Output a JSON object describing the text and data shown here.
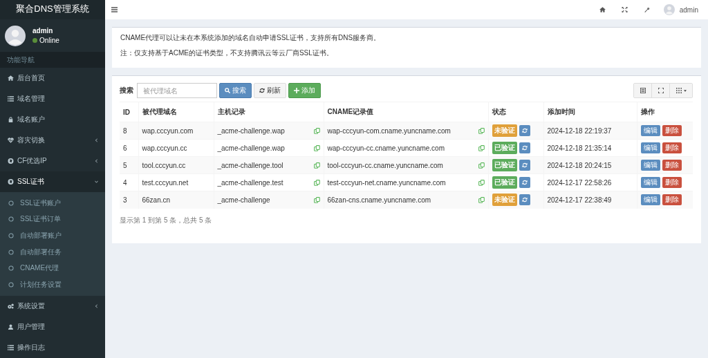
{
  "brand": "聚合DNS管理系统",
  "user": {
    "name": "admin",
    "status": "Online"
  },
  "nav_header": "功能导航",
  "sidebar": {
    "items": [
      {
        "label": "后台首页",
        "selected": false
      },
      {
        "label": "域名管理",
        "selected": false
      },
      {
        "label": "域名账户",
        "selected": false
      },
      {
        "label": "容灾切换",
        "expanded": false,
        "selected": false
      },
      {
        "label": "CF优选IP",
        "expanded": false,
        "selected": false
      },
      {
        "label": "SSL证书",
        "expanded": true,
        "selected": true,
        "children": [
          {
            "label": "SSL证书账户",
            "selected": false
          },
          {
            "label": "SSL证书订单",
            "selected": false
          },
          {
            "label": "自动部署账户",
            "selected": false
          },
          {
            "label": "自动部署任务",
            "selected": false
          },
          {
            "label": "CNAME代理",
            "selected": false
          },
          {
            "label": "计划任务设置",
            "selected": false
          }
        ]
      },
      {
        "label": "系统设置",
        "expanded": false,
        "selected": false
      },
      {
        "label": "用户管理",
        "selected": false
      },
      {
        "label": "操作日志",
        "selected": false
      }
    ]
  },
  "topbar": {
    "user": "admin"
  },
  "notice": [
    "CNAME代理可以让未在本系统添加的域名自动申请SSL证书，支持所有DNS服务商。",
    "注：仅支持基于ACME的证书类型，不支持腾讯云等云厂商SSL证书。"
  ],
  "toolbar": {
    "label": "搜索",
    "placeholder": "被代理域名",
    "buttons": [
      {
        "label": "搜索",
        "kind": "search"
      },
      {
        "label": "刷新",
        "kind": "refresh"
      },
      {
        "label": "添加",
        "kind": "add"
      }
    ]
  },
  "table": {
    "columns": [
      "ID",
      "被代理域名",
      "主机记录",
      "CNAME记录值",
      "状态",
      "添加时间",
      "操作"
    ],
    "rows": [
      {
        "id": "8",
        "domain": "wap.cccyun.com",
        "host": "_acme-challenge.wap",
        "cname": "wap-cccyun-com.cname.yuncname.com",
        "status": "未验证",
        "verified": false,
        "time": "2024-12-18 22:19:37",
        "actions": [
          "编辑",
          "删除"
        ]
      },
      {
        "id": "6",
        "domain": "wap.cccyun.cc",
        "host": "_acme-challenge.wap",
        "cname": "wap-cccyun-cc.cname.yuncname.com",
        "status": "已验证",
        "verified": true,
        "time": "2024-12-18 21:35:14",
        "actions": [
          "编辑",
          "删除"
        ]
      },
      {
        "id": "5",
        "domain": "tool.cccyun.cc",
        "host": "_acme-challenge.tool",
        "cname": "tool-cccyun-cc.cname.yuncname.com",
        "status": "已验证",
        "verified": true,
        "time": "2024-12-18 20:24:15",
        "actions": [
          "编辑",
          "删除"
        ]
      },
      {
        "id": "4",
        "domain": "test.cccyun.net",
        "host": "_acme-challenge.test",
        "cname": "test-cccyun-net.cname.yuncname.com",
        "status": "已验证",
        "verified": true,
        "time": "2024-12-17 22:58:26",
        "actions": [
          "编辑",
          "删除"
        ]
      },
      {
        "id": "3",
        "domain": "66zan.cn",
        "host": "_acme-challenge",
        "cname": "66zan-cns.cname.yuncname.com",
        "status": "未验证",
        "verified": false,
        "time": "2024-12-17 22:38:49",
        "actions": [
          "编辑",
          "删除"
        ]
      }
    ]
  },
  "pagination_info": "显示第 1 到第 5 条，总共 5 条"
}
